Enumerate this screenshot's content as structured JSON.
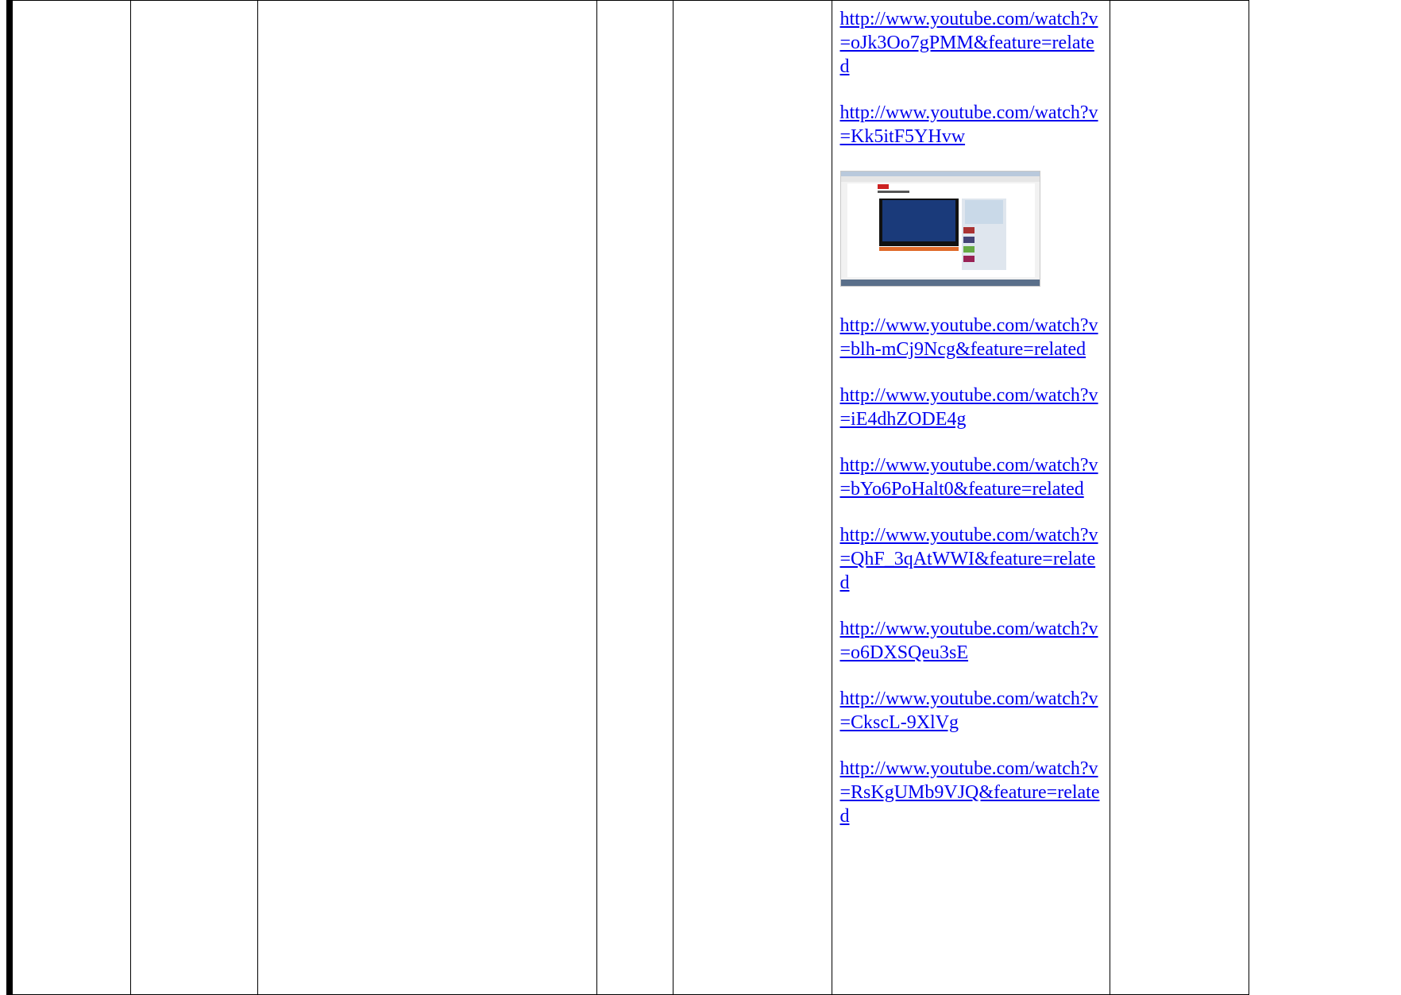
{
  "links": [
    "http://www.youtube.com/watch?v=oJk3Oo7gPMM&feature=related",
    "http://www.youtube.com/watch?v=Kk5itF5YHvw",
    "http://www.youtube.com/watch?v=blh-mCj9Ncg&feature=related",
    "http://www.youtube.com/watch?v=iE4dhZODE4g",
    "http://www.youtube.com/watch?v=bYo6PoHalt0&feature=related",
    "http://www.youtube.com/watch?v=QhF_3qAtWWI&feature=related",
    "http://www.youtube.com/watch?v=o6DXSQeu3sE",
    "http://www.youtube.com/watch?v=CkscL-9XlVg",
    "http://www.youtube.com/watch?v=RsKgUMb9VJQ&feature=related"
  ],
  "embedded_image": {
    "icon": "youtube-page-screenshot"
  }
}
